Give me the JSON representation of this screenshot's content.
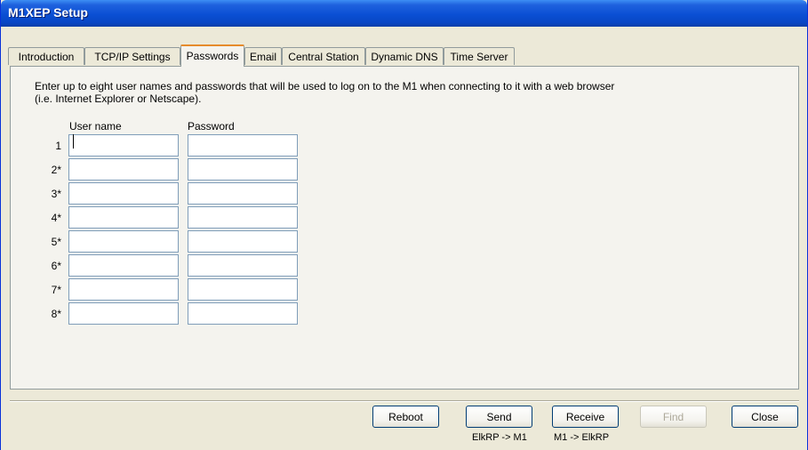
{
  "window": {
    "title": "M1XEP Setup"
  },
  "tabs": [
    {
      "label": "Introduction"
    },
    {
      "label": "TCP/IP Settings"
    },
    {
      "label": "Passwords"
    },
    {
      "label": "Email"
    },
    {
      "label": "Central Station"
    },
    {
      "label": "Dynamic DNS"
    },
    {
      "label": "Time Server"
    }
  ],
  "active_tab": "Passwords",
  "instructions": {
    "line1": "Enter up to eight user names and passwords that will be used to log on to the M1 when connecting to it with a web browser",
    "line2": "(i.e. Internet Explorer or Netscape)."
  },
  "columns": {
    "username": "User name",
    "password": "Password"
  },
  "rows": [
    {
      "label": "1",
      "username": "",
      "password": ""
    },
    {
      "label": "2*",
      "username": "",
      "password": ""
    },
    {
      "label": "3*",
      "username": "",
      "password": ""
    },
    {
      "label": "4*",
      "username": "",
      "password": ""
    },
    {
      "label": "5*",
      "username": "",
      "password": ""
    },
    {
      "label": "6*",
      "username": "",
      "password": ""
    },
    {
      "label": "7*",
      "username": "",
      "password": ""
    },
    {
      "label": "8*",
      "username": "",
      "password": ""
    }
  ],
  "buttons": {
    "reboot": "Reboot",
    "send": "Send",
    "send_sub": "ElkRP -> M1",
    "receive": "Receive",
    "receive_sub": "M1 -> ElkRP",
    "find": "Find",
    "close": "Close"
  },
  "colors": {
    "titlebar": "#0a4fd4",
    "active_tab_accent": "#e68b2c",
    "background": "#ece9d8"
  }
}
